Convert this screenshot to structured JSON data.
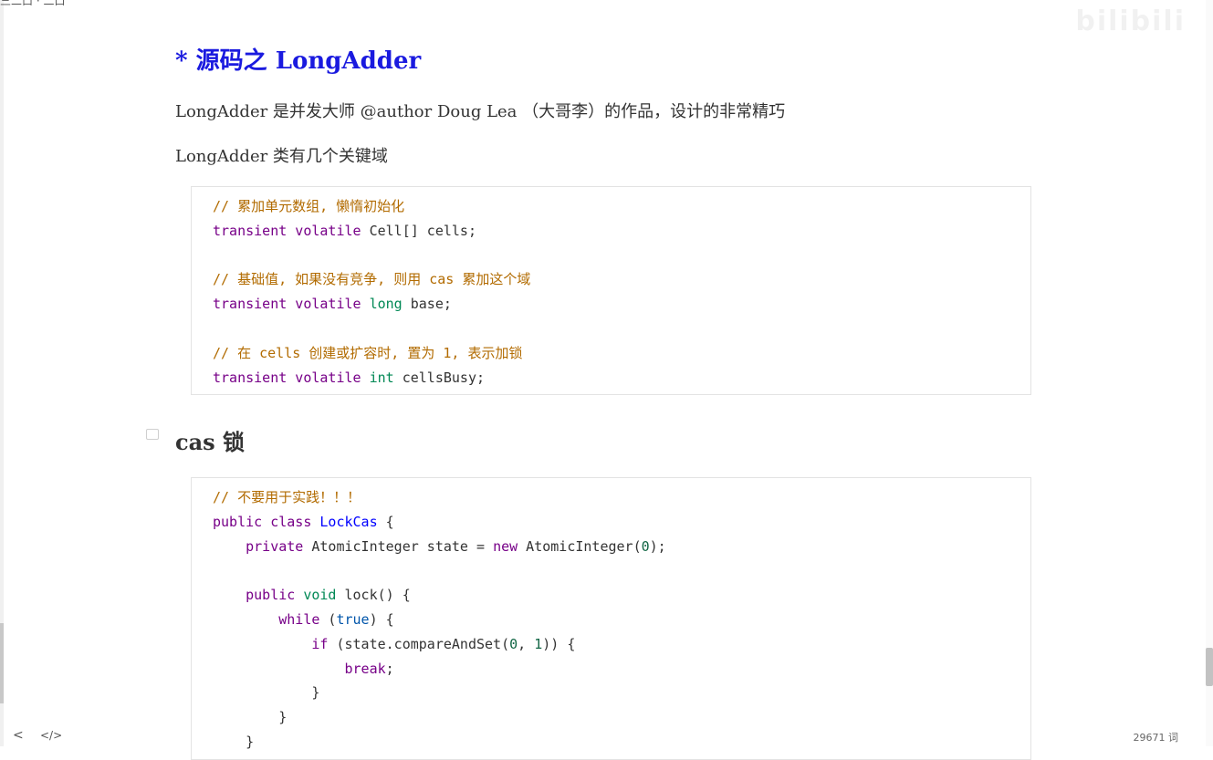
{
  "top_fragment": "三二口 · 二口",
  "watermark": "bilibili",
  "heading": "* 源码之 LongAdder",
  "para1": "LongAdder 是并发大师 @author Doug Lea （大哥李）的作品，设计的非常精巧",
  "para2": "LongAdder 类有几个关键域",
  "code1": {
    "comment1": "// 累加单元数组, 懒惰初始化",
    "line1_kw": "transient volatile",
    "line1_rest": " Cell[] cells;",
    "comment2": "// 基础值, 如果没有竞争, 则用 cas 累加这个域",
    "line2_kw": "transient volatile",
    "line2_type": "long",
    "line2_rest": " base;",
    "comment3": "// 在 cells 创建或扩容时, 置为 1, 表示加锁",
    "line3_kw": "transient volatile",
    "line3_type": "int",
    "line3_rest": " cellsBusy;"
  },
  "heading2": "cas 锁",
  "code2": {
    "comment": "// 不要用于实践！！！",
    "class_kw": "public class",
    "class_name": "LockCas",
    "class_open": " {",
    "field_kw": "private",
    "field_type": " AtomicInteger state = ",
    "field_new": "new",
    "field_ctor": " AtomicInteger(",
    "field_num": "0",
    "field_end": ");",
    "method_kw": "public",
    "method_void": "void",
    "method_sig": " lock() {",
    "while_kw": "while",
    "while_open": " (",
    "while_true": "true",
    "while_close": ") {",
    "if_kw": "if",
    "if_call": " (state.compareAndSet(",
    "if_n0": "0",
    "if_sep": ", ",
    "if_n1": "1",
    "if_close": ")) {",
    "break_kw": "break",
    "break_end": ";",
    "brace1": "}",
    "brace2": "}",
    "brace3": "}"
  },
  "footer": {
    "nav_back": "<",
    "code_toggle": "</>",
    "wordcount": "29671 词"
  }
}
